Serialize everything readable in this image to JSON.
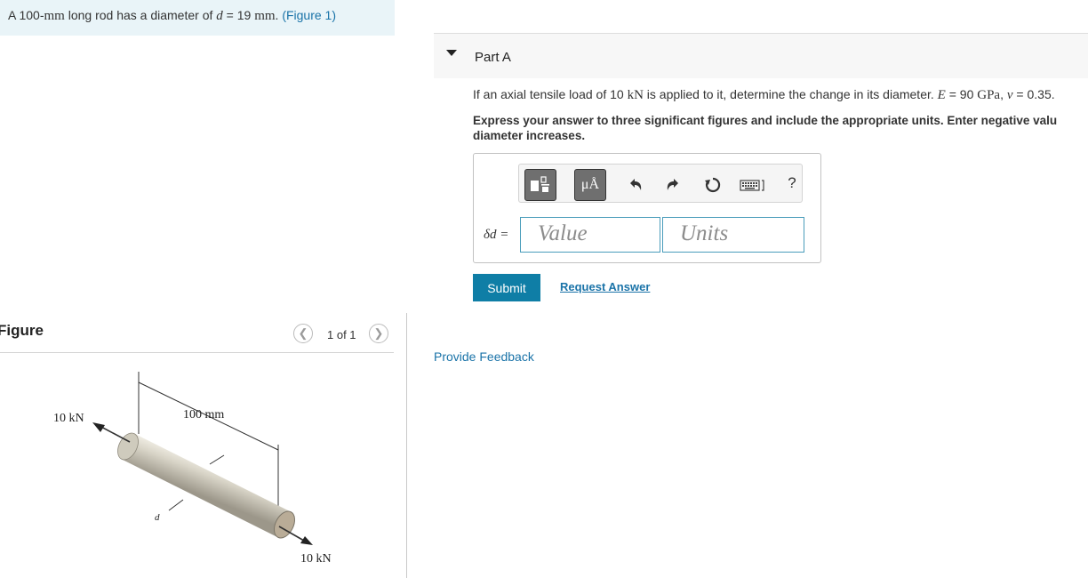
{
  "problem": {
    "text_before": "A 100-",
    "unit_mm": "mm",
    "text_middle": " long rod has a diameter of ",
    "var_d": "d",
    "equals_value": " = 19 ",
    "unit_mm2": "mm",
    "period": ". ",
    "figure_link": "(Figure 1)"
  },
  "figure_panel": {
    "title": "Figure",
    "page_indicator": "1 of 1",
    "prev_icon": "chevron-left-icon",
    "next_icon": "chevron-right-icon",
    "labels": {
      "load_left": "10 kN",
      "length": "100 mm",
      "diameter": "d",
      "load_right": "10 kN"
    }
  },
  "part_a": {
    "title": "Part A",
    "question_before": "If an axial tensile load of 10 ",
    "question_unit": "kN",
    "question_mid": " is applied to it, determine the change in its diameter. ",
    "question_E": "E",
    "question_E_value": " = 90 ",
    "question_E_unit": "GPa",
    "question_comma": ", ",
    "question_nu": "v",
    "question_nu_value": " = 0.35.",
    "instruction_line1": "Express your answer to three significant figures and include the appropriate units. Enter negative valu",
    "instruction_line2": "diameter increases.",
    "answer_label": "δd =",
    "value_placeholder": "Value",
    "units_placeholder": "Units",
    "toolbar": {
      "units_button": "μÅ",
      "help": "?",
      "icons": [
        "templates-icon",
        "units-icon",
        "undo-icon",
        "redo-icon",
        "reset-icon",
        "keyboard-icon",
        "help-icon"
      ]
    },
    "submit_label": "Submit",
    "request_answer_label": "Request Answer"
  },
  "feedback_label": "Provide Feedback",
  "colors": {
    "accent": "#0f7ea6",
    "link": "#1a73a8",
    "banner_bg": "#e9f4f8",
    "input_border": "#4a9dbb"
  }
}
